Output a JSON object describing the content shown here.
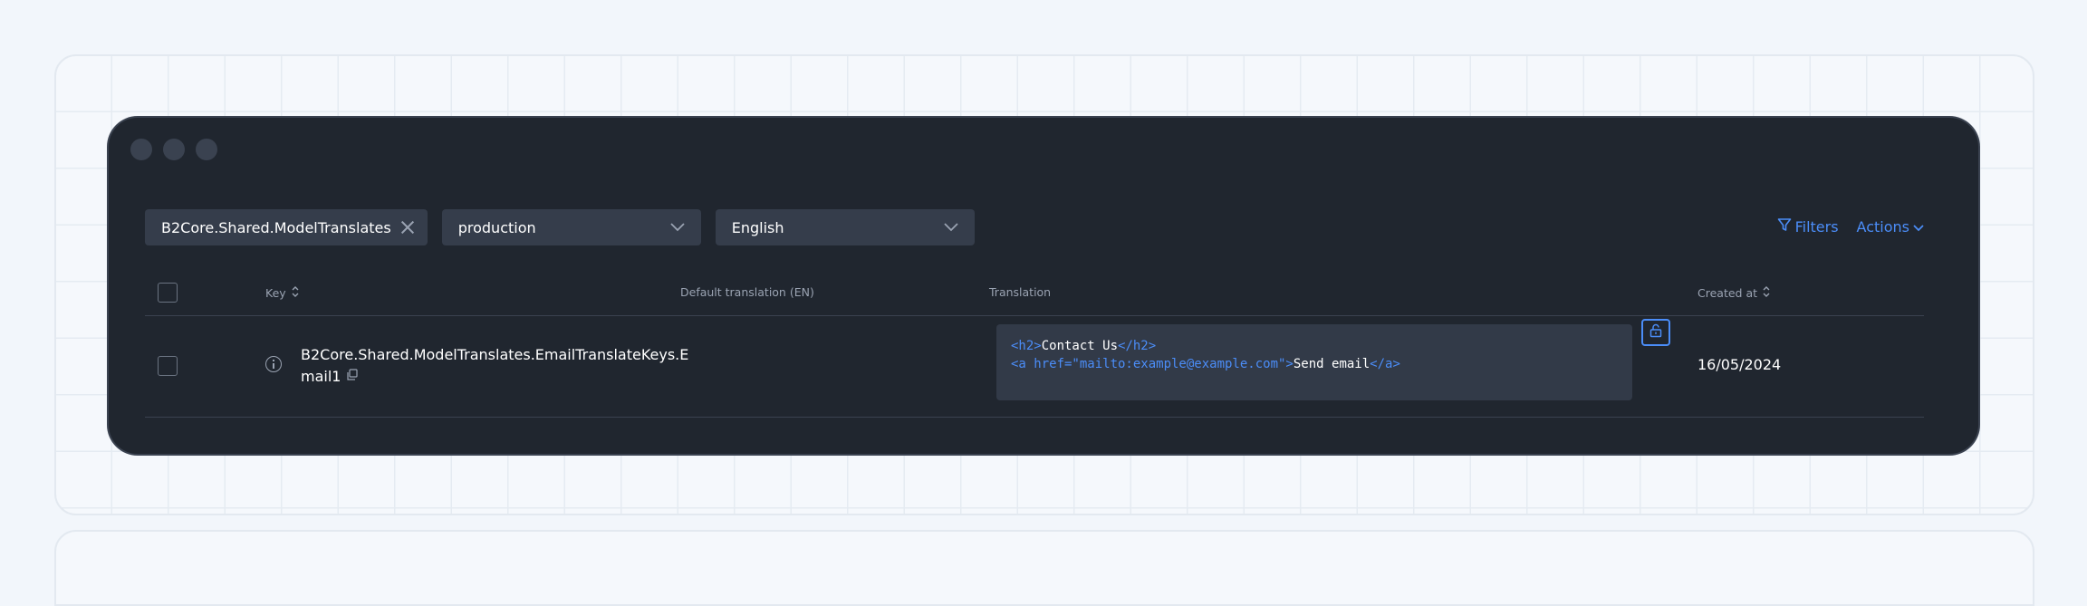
{
  "filters": {
    "tag_label": "B2Core.Shared.ModelTranslates",
    "environment": "production",
    "language": "English"
  },
  "top_actions": {
    "filters_label": "Filters",
    "actions_label": "Actions"
  },
  "table": {
    "columns": {
      "key": "Key",
      "default_translation": "Default translation (EN)",
      "translation": "Translation",
      "created_at": "Created at"
    },
    "rows": [
      {
        "key_line1": "B2Core.Shared.ModelTranslates.EmailTranslateKeys.E",
        "key_line2": "mail1",
        "default_translation": "",
        "translation": {
          "line1_open": "<h2>",
          "line1_text": "Contact Us",
          "line1_close": "</h2>",
          "line2_open": "<a href=\"mailto:example@example.com\">",
          "line2_text": "Send email",
          "line2_close": "</a>"
        },
        "created_at": "16/05/2024"
      }
    ]
  },
  "colors": {
    "accent": "#4b8df8",
    "window_bg": "#20262f",
    "page_bg": "#f2f6fb"
  }
}
